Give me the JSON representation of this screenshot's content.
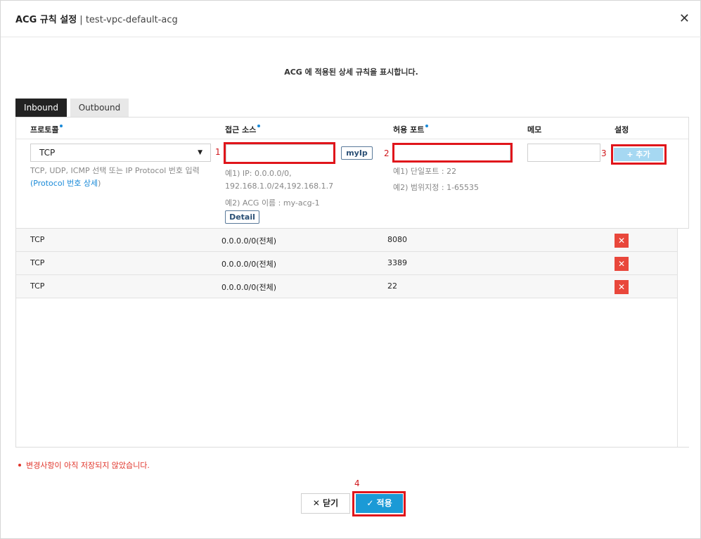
{
  "dialog": {
    "title": "ACG 규칙 설정",
    "separator": " | ",
    "acg_name": "test-vpc-default-acg",
    "close_symbol": "✕"
  },
  "info_text": "ACG 에 적용된 상세 규칙을 표시합니다.",
  "tabs": [
    {
      "label": "Inbound",
      "active": true
    },
    {
      "label": "Outbound",
      "active": false
    }
  ],
  "columns": {
    "protocol": "프로토콜",
    "source": "접근 소스",
    "port": "허용 포트",
    "memo": "메모",
    "settings": "설정"
  },
  "form": {
    "protocol_value": "TCP",
    "protocol_hint_line1": "TCP, UDP, ICMP 선택 또는 IP Protocol 번호 입력",
    "protocol_hint_open": "(",
    "protocol_hint_link": "Protocol 번호 상세",
    "protocol_hint_close": ")",
    "source_value": "",
    "myip_label": "myIp",
    "source_hint_line1": "예1) IP: 0.0.0.0/0,",
    "source_hint_line2": "192.168.1.0/24,192.168.1.7",
    "source_hint_line3": "예2) ACG 이름 : my-acg-1",
    "detail_label": "Detail",
    "port_value": "",
    "port_hint_line1": "예1) 단일포트 : 22",
    "port_hint_line2": "예2) 범위지정 : 1-65535",
    "memo_value": "",
    "add_label": "+ 추가"
  },
  "rules": [
    {
      "protocol": "TCP",
      "source": "0.0.0.0/0(전체)",
      "port": "8080",
      "delete": "✕"
    },
    {
      "protocol": "TCP",
      "source": "0.0.0.0/0(전체)",
      "port": "3389",
      "delete": "✕"
    },
    {
      "protocol": "TCP",
      "source": "0.0.0.0/0(전체)",
      "port": "22",
      "delete": "✕"
    }
  ],
  "annotations": [
    "1",
    "2",
    "3",
    "4"
  ],
  "warning": "변경사항이 아직 저장되지 않았습니다.",
  "footer": {
    "close_label": "✕ 닫기",
    "apply_label": "✓ 적용"
  },
  "colors": {
    "accent": "#1b9ad6",
    "highlight": "#e0151b",
    "delete": "#e9473b"
  }
}
